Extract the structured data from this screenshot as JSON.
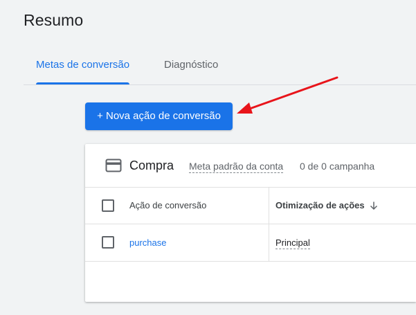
{
  "page": {
    "title": "Resumo"
  },
  "tabs": [
    {
      "label": "Metas de conversão",
      "active": true
    },
    {
      "label": "Diagnóstico",
      "active": false
    }
  ],
  "new_action_button": {
    "label": "+ Nova ação de conversão"
  },
  "goal_card": {
    "icon": "credit-card-icon",
    "title": "Compra",
    "goal_type": "Meta padrão da conta",
    "campaigns": "0 de 0 campanha"
  },
  "table": {
    "columns": [
      {
        "label": "Ação de conversão"
      },
      {
        "label": "Otimização de ações",
        "sort": "descending"
      }
    ],
    "rows": [
      {
        "action": "purchase",
        "optimization": "Principal"
      }
    ]
  },
  "colors": {
    "accent": "#1a73e8",
    "annotation_arrow": "#e8141a",
    "background": "#f1f3f4"
  }
}
